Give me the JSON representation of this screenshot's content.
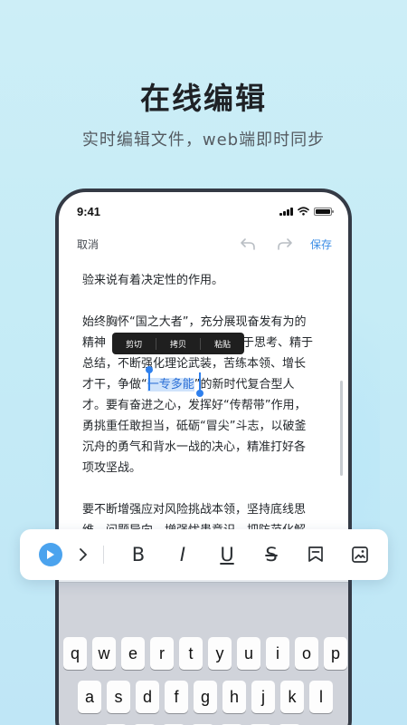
{
  "promo": {
    "title": "在线编辑",
    "subtitle": "实时编辑文件，web端即时同步"
  },
  "status_bar": {
    "time": "9:41"
  },
  "editor_toolbar": {
    "cancel_label": "取消",
    "undo_icon": "undo-icon",
    "redo_icon": "redo-icon",
    "save_label": "保存"
  },
  "document": {
    "lines": [
      "验来说有着决定性的作用。",
      "始终胸怀“国之大者”，充分展现奋发有为的",
      "精神",
      "于思考、精于",
      "总结，不断强化理论武装，苦练本领、增长",
      "才干，争做“",
      "一专多能",
      "”的新时代复合型人",
      "才。要有奋进之心，发挥好“传帮带”作用，",
      "勇挑重任敢担当，砥砺“冒尖”斗志，以破釜",
      "沉舟的勇气和背水一战的决心，精准打好各",
      "项攻坚战。",
      "要不断增强应对风险挑战本领，坚持底线思",
      "维、问题导向，增强忧患意识，把防范化解"
    ],
    "selected_text": "一专多能"
  },
  "context_menu": {
    "items": [
      "剪切",
      "拷贝",
      "粘贴"
    ]
  },
  "keyboard": {
    "row1": [
      "q",
      "w",
      "e",
      "r",
      "t",
      "y",
      "u",
      "i",
      "o",
      "p"
    ],
    "row2": [
      "a",
      "s",
      "d",
      "f",
      "g",
      "h",
      "j",
      "k",
      "l"
    ]
  },
  "format_bar": {
    "bold": "B",
    "italic": "I",
    "underline": "U",
    "strikethrough": "S",
    "icons": [
      "play-icon",
      "chevron-right-icon",
      "bold-icon",
      "italic-icon",
      "underline-icon",
      "strikethrough-icon",
      "comment-icon",
      "image-icon"
    ]
  },
  "colors": {
    "accent": "#3b8de6",
    "selection": "#cfe3fb",
    "play": "#4ba3ee"
  }
}
